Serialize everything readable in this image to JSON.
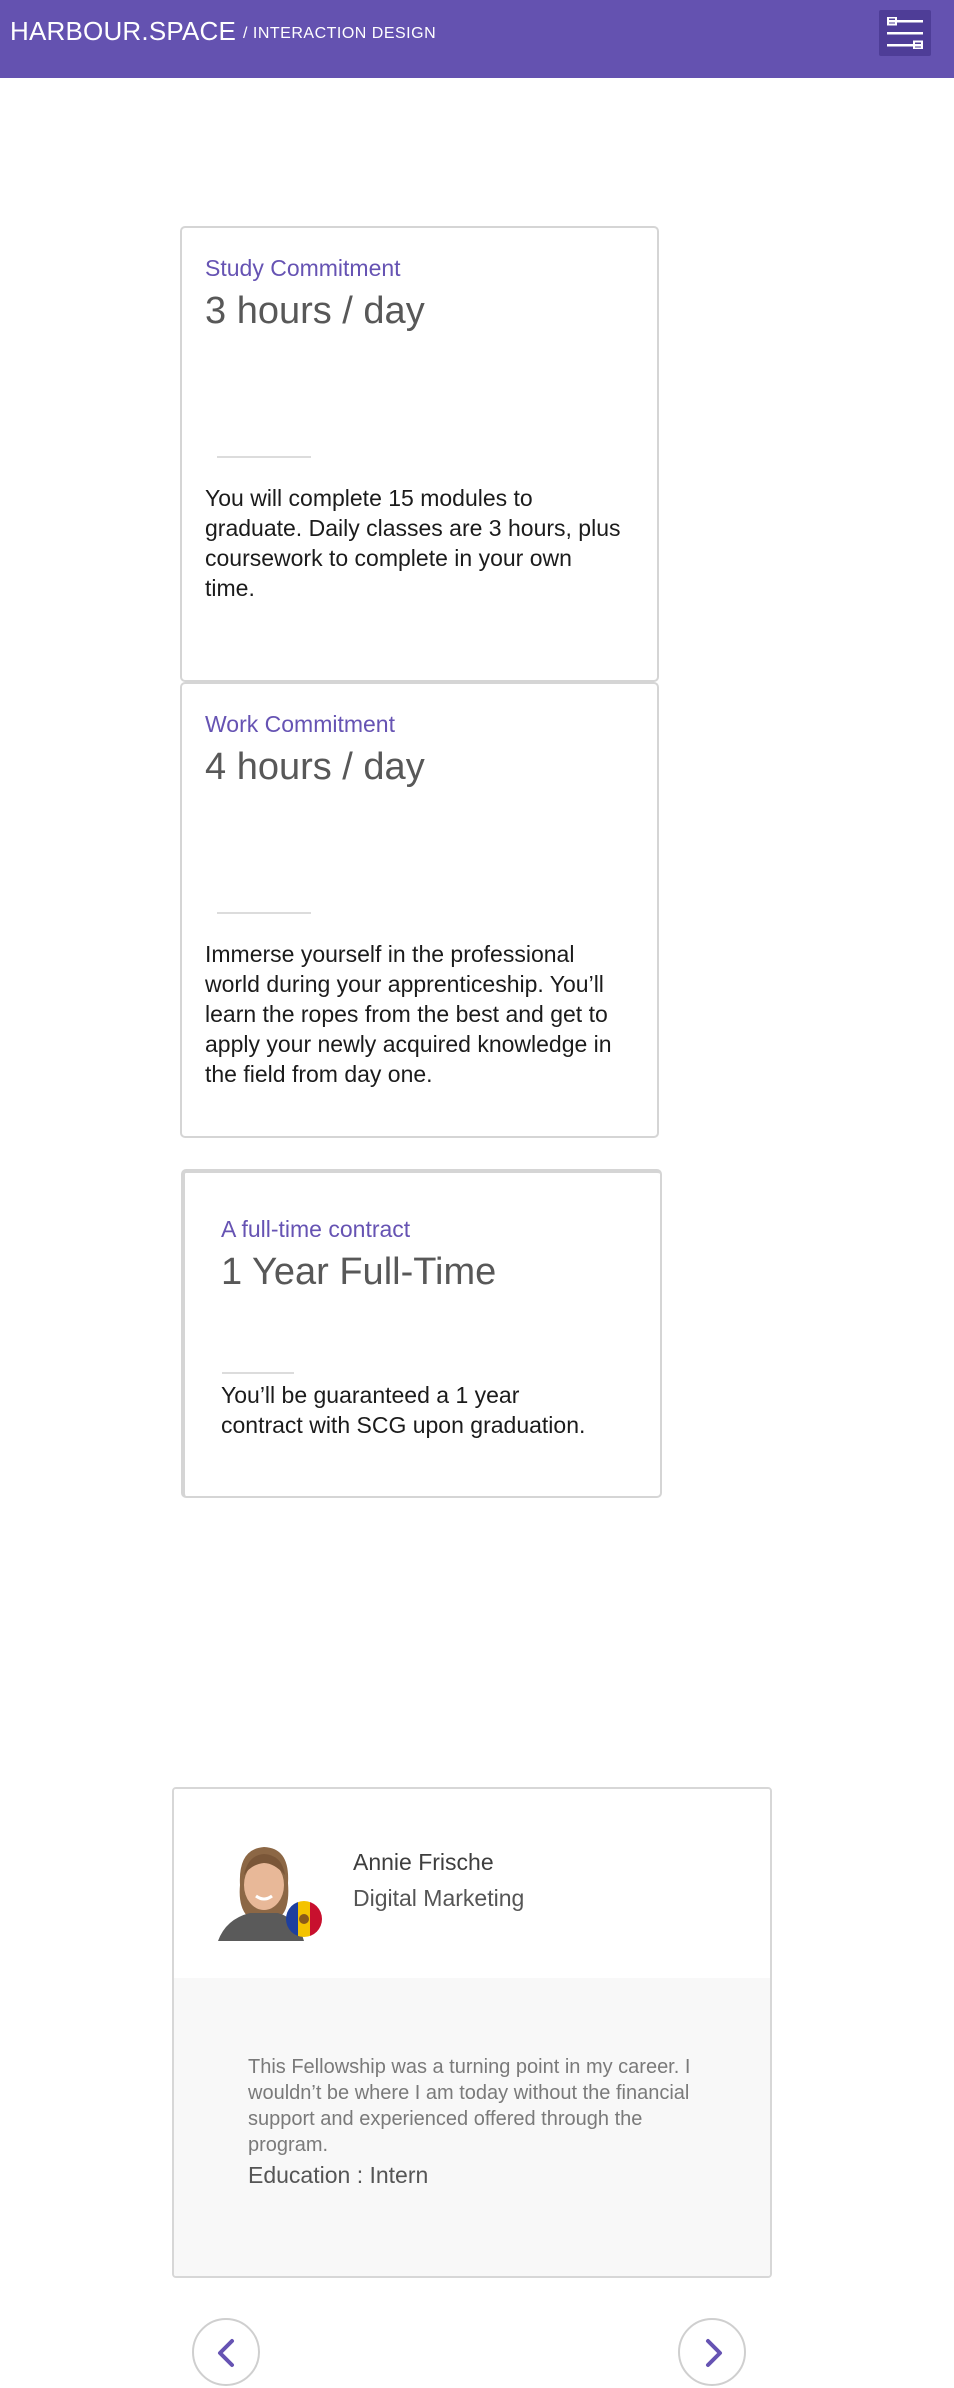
{
  "header": {
    "brand": "HARBOUR.SPACE",
    "subtitle": "/ INTERACTION DESIGN",
    "menu_icon": "menu-sliders-icon"
  },
  "cards": [
    {
      "label": "Study Commitment",
      "value": "3 hours / day",
      "description": "You will complete 15 modules to graduate. Daily classes are 3 hours, plus coursework to complete in your own time."
    },
    {
      "label": "Work Commitment",
      "value": "4 hours / day",
      "description": "Immerse yourself in the professional world during your apprenticeship. You’ll learn the ropes from the best and get to apply your newly acquired knowledge in the field from day one."
    },
    {
      "label": "A full-time contract",
      "value": "1 Year Full-Time",
      "description": "You’ll be guaranteed a 1 year contract with SCG upon graduation."
    }
  ],
  "testimonial": {
    "name": "Annie Frische",
    "role": "Digital Marketing",
    "quote": "This Fellowship was a turning point in my career. I wouldn’t be where I am today without the financial support and experienced offered through the program.",
    "meta": "Education : Intern"
  },
  "carousel": {
    "prev_icon": "chevron-left-icon",
    "next_icon": "chevron-right-icon"
  },
  "colors": {
    "header_bg": "#6452b0",
    "accent": "#6653b3"
  }
}
